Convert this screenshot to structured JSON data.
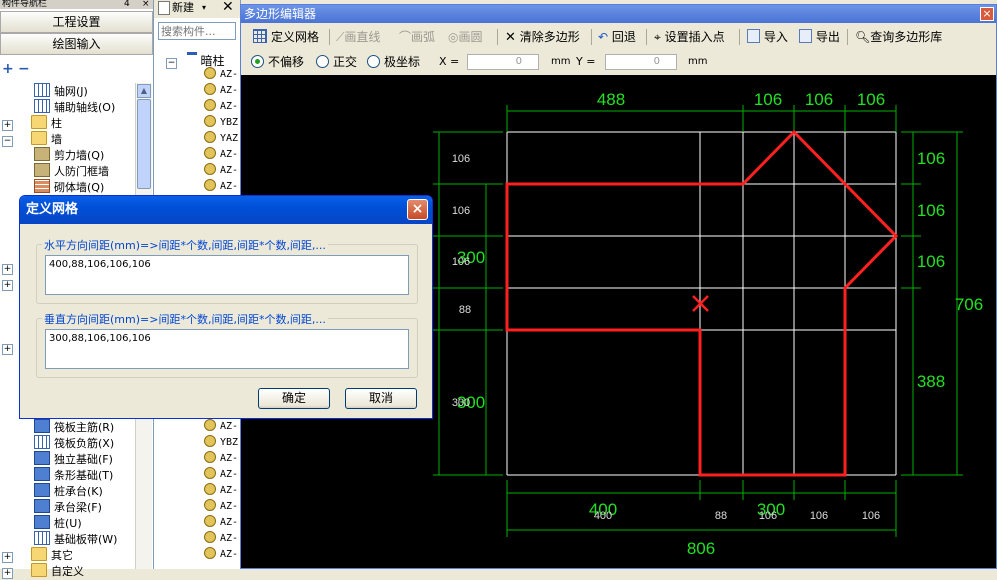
{
  "nav": {
    "header": "构件导航栏",
    "pin": "4",
    "btn_project": "工程设置",
    "btn_draw": "绘图输入",
    "tree": [
      {
        "label": "轴网(J)",
        "icon": "grid-icon",
        "indent": 2
      },
      {
        "label": "辅助轴线(O)",
        "icon": "grid-icon",
        "indent": 2
      },
      {
        "label": "柱",
        "icon": "folder-icon",
        "indent": 1
      },
      {
        "label": "墙",
        "icon": "folder-icon",
        "indent": 1
      },
      {
        "label": "剪力墙(Q)",
        "icon": "wall-icon",
        "indent": 2
      },
      {
        "label": "人防门框墙",
        "icon": "wall-icon",
        "indent": 2
      },
      {
        "label": "砌体墙(Q)",
        "icon": "brick-icon",
        "indent": 2
      }
    ],
    "tree_bottom": [
      {
        "label": "筏板主筋(R)",
        "indent": 2
      },
      {
        "label": "筏板负筋(X)",
        "indent": 2
      },
      {
        "label": "独立基础(F)",
        "indent": 2
      },
      {
        "label": "条形基础(T)",
        "indent": 2
      },
      {
        "label": "桩承台(K)",
        "indent": 2
      },
      {
        "label": "承台梁(F)",
        "indent": 2
      },
      {
        "label": "桩(U)",
        "indent": 2
      },
      {
        "label": "基础板带(W)",
        "indent": 2
      },
      {
        "label": "其它",
        "indent": 1
      },
      {
        "label": "自定义",
        "indent": 1
      }
    ]
  },
  "col2": {
    "new_label": "新建",
    "search_placeholder": "搜索构件...",
    "root": "暗柱",
    "items": [
      "AZ-",
      "AZ-",
      "AZ-",
      "YBZ",
      "YAZ",
      "AZ-",
      "AZ-",
      "AZ-"
    ],
    "items_bottom": [
      "AZ-",
      "YBZ",
      "AZ-",
      "AZ-",
      "AZ-",
      "AZ-",
      "AZ-",
      "AZ-",
      "AZ-"
    ]
  },
  "editor": {
    "title": "多边形编辑器",
    "close": "×",
    "toolbar": {
      "define_grid": "定义网格",
      "line": "画直线",
      "arc": "画弧",
      "circle": "画圆",
      "clear": "清除多边形",
      "undo": "回退",
      "insert_point": "设置插入点",
      "import": "导入",
      "export": "导出",
      "query": "查询多边形库"
    },
    "options": {
      "no_offset": "不偏移",
      "ortho": "正交",
      "polar": "极坐标",
      "x_label": "X =",
      "x_value": "0",
      "x_unit": "mm",
      "y_label": "Y =",
      "y_value": "0",
      "y_unit": "mm"
    }
  },
  "drawing": {
    "top_dims": [
      "488",
      "106",
      "106",
      "106"
    ],
    "right_dims": [
      "106",
      "106",
      "106",
      "388"
    ],
    "right_total": "706",
    "bottom_dims_big": [
      "400",
      "300"
    ],
    "bottom_dims_small": [
      "400",
      "88",
      "106",
      "106",
      "106"
    ],
    "bottom_total": "806",
    "left_dims": [
      "106",
      "106",
      "106",
      "88"
    ],
    "left_big": [
      "300",
      "300"
    ],
    "left_small_bottom": "300",
    "colors": {
      "grid": "#ffffff",
      "dims": "#00c000",
      "dim_text": "#22e022",
      "polygon": "#ff2020",
      "canvas": "#000000"
    }
  },
  "dialog": {
    "title": "定义网格",
    "close": "×",
    "horizontal_label": "水平方向间距(mm)=>间距*个数,间距,间距*个数,间距,...",
    "horizontal_value": "400,88,106,106,106",
    "vertical_label": "垂直方向间距(mm)=>间距*个数,间距,间距*个数,间距,...",
    "vertical_value": "300,88,106,106,106",
    "ok": "确定",
    "cancel": "取消"
  }
}
